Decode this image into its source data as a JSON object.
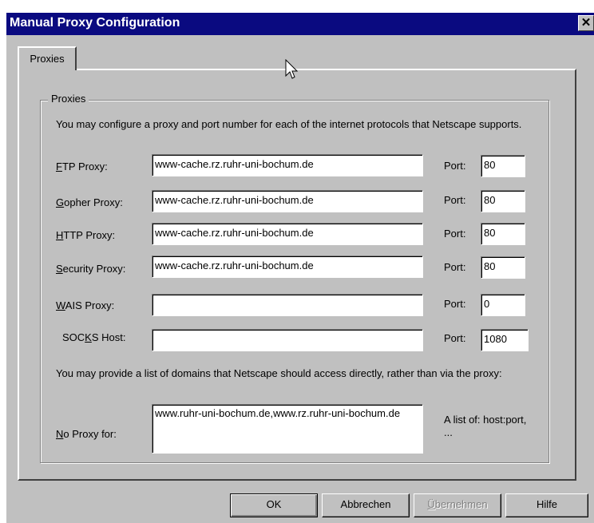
{
  "window": {
    "title": "Manual Proxy Configuration",
    "close_glyph": "✕"
  },
  "tabs": [
    {
      "label": "Proxies",
      "active": true
    }
  ],
  "group": {
    "legend": "Proxies",
    "intro": "You may configure a proxy and port number for each of the internet protocols that Netscape supports.",
    "port_label": "Port:",
    "rows": [
      {
        "label_pre": "",
        "label_key": "F",
        "label_post": "TP Proxy:",
        "value": "www-cache.rz.ruhr-uni-bochum.de",
        "port": "80"
      },
      {
        "label_pre": "",
        "label_key": "G",
        "label_post": "opher Proxy:",
        "value": "www-cache.rz.ruhr-uni-bochum.de",
        "port": "80"
      },
      {
        "label_pre": "",
        "label_key": "H",
        "label_post": "TTP Proxy:",
        "value": "www-cache.rz.ruhr-uni-bochum.de",
        "port": "80"
      },
      {
        "label_pre": "",
        "label_key": "S",
        "label_post": "ecurity Proxy:",
        "value": "www-cache.rz.ruhr-uni-bochum.de",
        "port": "80"
      },
      {
        "label_pre": "",
        "label_key": "W",
        "label_post": "AIS Proxy:",
        "value": "",
        "port": "0"
      },
      {
        "label_pre": "SOC",
        "label_key": "K",
        "label_post": "S Host:",
        "value": "",
        "port": "1080"
      }
    ],
    "direct_text": "You may provide a list of domains that Netscape should access directly, rather than via the proxy:",
    "no_proxy": {
      "label_key": "N",
      "label_post": "o Proxy for:",
      "value": "www.ruhr-uni-bochum.de,www.rz.ruhr-uni-bochum.de",
      "hint": "A list of: host:port, ..."
    }
  },
  "buttons": {
    "ok": "OK",
    "cancel": "Abbrechen",
    "apply_key": "Ü",
    "apply_post": "bernehmen",
    "help": "Hilfe"
  },
  "colors": {
    "titlebar": "#0a0a80",
    "face": "#c0c0c0"
  }
}
